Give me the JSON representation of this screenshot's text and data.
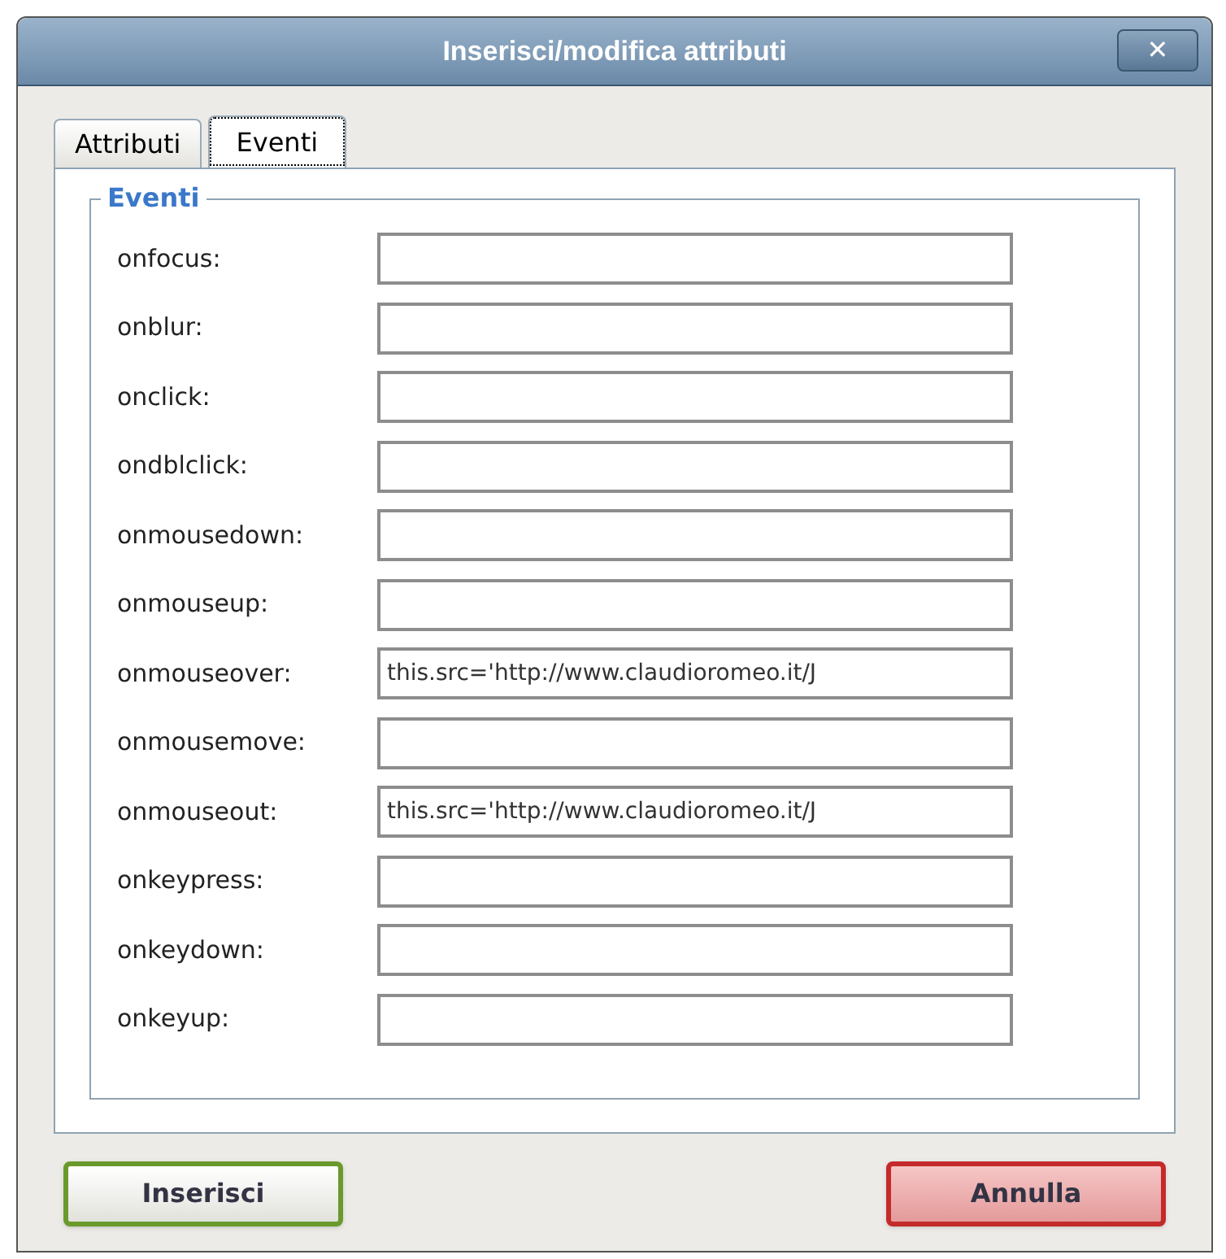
{
  "window": {
    "title": "Inserisci/modifica attributi",
    "close": "✕"
  },
  "tabs": [
    {
      "label": "Attributi",
      "selected": false
    },
    {
      "label": "Eventi",
      "selected": true
    }
  ],
  "fieldset": {
    "legend": "Eventi",
    "fields": [
      {
        "label": "onfocus:"
      },
      {
        "label": "onblur:"
      },
      {
        "label": "onclick:"
      },
      {
        "label": "ondblclick:"
      },
      {
        "label": "onmousedown:"
      },
      {
        "label": "onmouseup:"
      },
      {
        "label": "onmouseover:",
        "value": "this.src='http://www.claudioromeo.it/J"
      },
      {
        "label": "onmousemove:"
      },
      {
        "label": "onmouseout:",
        "value": "this.src='http://www.claudioromeo.it/J"
      },
      {
        "label": "onkeypress:"
      },
      {
        "label": "onkeydown:"
      },
      {
        "label": "onkeyup:"
      }
    ]
  },
  "buttons": [
    {
      "label": "Inserisci",
      "kind": "confirm"
    },
    {
      "label": "Annulla",
      "kind": "cancel"
    }
  ]
}
